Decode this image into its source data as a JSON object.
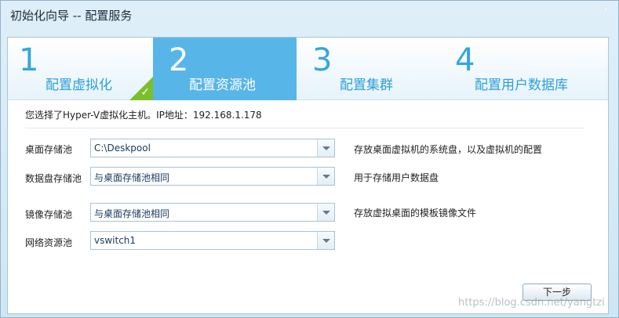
{
  "window": {
    "title": "初始化向导 -- 配置服务",
    "close_label": "×"
  },
  "steps": [
    {
      "num": "1",
      "label": "配置虚拟化",
      "state": "done"
    },
    {
      "num": "2",
      "label": "配置资源池",
      "state": "active"
    },
    {
      "num": "3",
      "label": "配置集群",
      "state": "pending"
    },
    {
      "num": "4",
      "label": "配置用户数据库",
      "state": "pending"
    }
  ],
  "check_glyph": "✓",
  "info": "您选择了Hyper-V虚拟化主机。IP地址：192.168.1.178",
  "fields": [
    {
      "label": "桌面存储池",
      "value": "C:\\Deskpool",
      "desc": "存放桌面虚拟机的系统盘，以及虚拟机的配置"
    },
    {
      "label": "数据盘存储池",
      "value": "与桌面存储池相同",
      "desc": "用于存储用户数据盘"
    },
    {
      "label": "镜像存储池",
      "value": "与桌面存储池相同",
      "desc": "存放虚拟桌面的模板镜像文件"
    },
    {
      "label": "网络资源池",
      "value": "vswitch1",
      "desc": ""
    }
  ],
  "next_button": "下一步",
  "watermark": "https://blog.csdn.net/yangtzi",
  "colors": {
    "accent": "#58b5e8",
    "step_text": "#2d9fd8",
    "done_green": "#7bbf2a"
  }
}
